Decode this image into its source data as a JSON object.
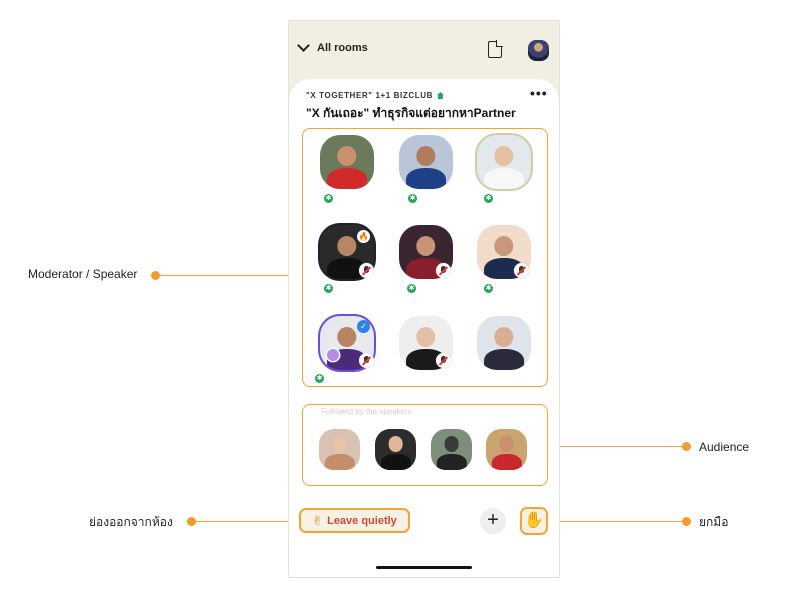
{
  "header": {
    "all_rooms": "All rooms",
    "document_icon": "document-icon",
    "avatar": "profile-avatar"
  },
  "room": {
    "club": "\"X TOGETHER\" 1+1 BIZCLUB",
    "title": "\"X กันเถอะ\" ทำธุรกิจแต่อยากหาPartner",
    "more_label": "•••"
  },
  "speakers": [
    {
      "moderator": true,
      "muted": false,
      "name": ""
    },
    {
      "moderator": true,
      "muted": false,
      "name": ""
    },
    {
      "moderator": true,
      "muted": false,
      "name": ""
    },
    {
      "moderator": true,
      "muted": true,
      "name": ""
    },
    {
      "moderator": true,
      "muted": true,
      "name": ""
    },
    {
      "moderator": true,
      "muted": true,
      "name": ""
    },
    {
      "moderator": true,
      "muted": true,
      "name": ""
    },
    {
      "moderator": false,
      "muted": true,
      "name": ""
    },
    {
      "moderator": false,
      "muted": true,
      "name": ""
    }
  ],
  "audience": {
    "section_label": "Followed by the speakers"
  },
  "footer": {
    "leave_label": "Leave quietly",
    "leave_icon": "✌",
    "plus_label": "+",
    "raise_hand_icon": "✋"
  },
  "annotations": {
    "moderator_speaker": "Moderator / Speaker",
    "audience": "Audience",
    "leave_quietly_th": "ย่องออกจากห้อง",
    "raise_hand_th": "ยกมือ"
  },
  "colors": {
    "accent_orange": "#f0a43a",
    "moderator_green": "#27a65a",
    "phone_background": "#f1efe4",
    "leave_text": "#d04a30"
  }
}
